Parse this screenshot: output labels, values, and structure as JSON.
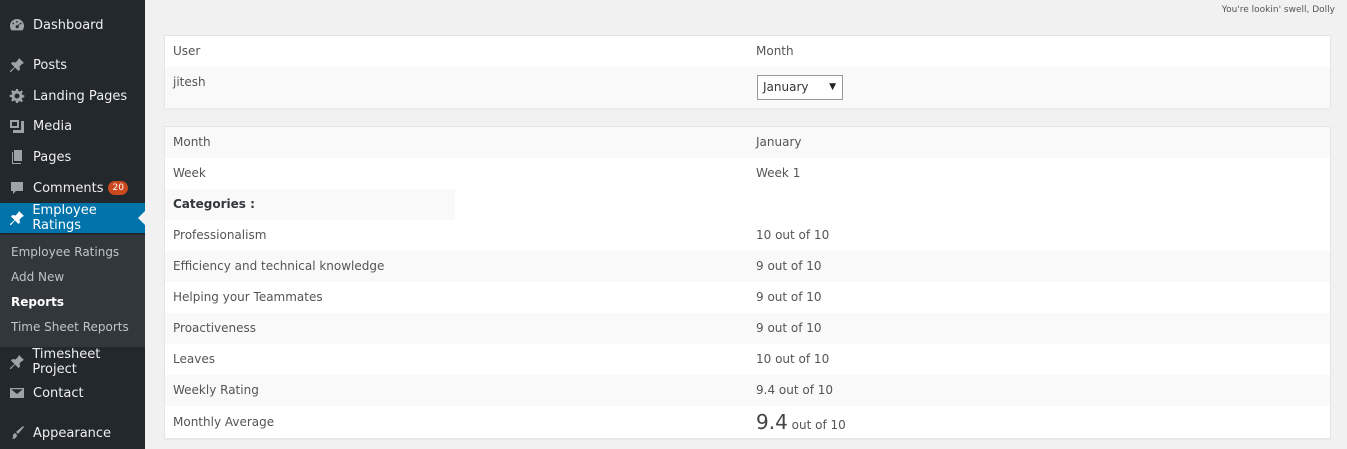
{
  "sidebar": {
    "items": [
      {
        "label": "Dashboard",
        "icon": "dashboard-icon"
      },
      {
        "label": "Posts",
        "icon": "pin-icon"
      },
      {
        "label": "Landing Pages",
        "icon": "gear-icon"
      },
      {
        "label": "Media",
        "icon": "media-icon"
      },
      {
        "label": "Pages",
        "icon": "pages-icon"
      },
      {
        "label": "Comments",
        "icon": "comment-icon",
        "badge": "20"
      },
      {
        "label": "Employee Ratings",
        "icon": "pin-icon"
      },
      {
        "label": "Timesheet Project",
        "icon": "pin-icon"
      },
      {
        "label": "Contact",
        "icon": "mail-icon"
      },
      {
        "label": "Appearance",
        "icon": "brush-icon"
      }
    ],
    "submenu": [
      "Employee Ratings",
      "Add New",
      "Reports",
      "Time Sheet Reports"
    ]
  },
  "header": {
    "dolly": "You're lookin' swell, Dolly"
  },
  "filter_table": {
    "col_user": "User",
    "col_month": "Month",
    "user_value": "jitesh",
    "month_selected": "January"
  },
  "report_table": {
    "month_label": "Month",
    "month_value": "January",
    "week_label": "Week",
    "week_value": "Week 1",
    "categories_label": "Categories :",
    "rows": [
      {
        "label": "Professionalism",
        "value": "10 out of 10"
      },
      {
        "label": "Efficiency and technical knowledge",
        "value": "9 out of 10"
      },
      {
        "label": "Helping your Teammates",
        "value": "9 out of 10"
      },
      {
        "label": "Proactiveness",
        "value": "9 out of 10"
      },
      {
        "label": "Leaves",
        "value": "10 out of 10"
      },
      {
        "label": "Weekly Rating",
        "value": "9.4 out of 10"
      }
    ],
    "monthly_label": "Monthly Average",
    "monthly_value": "9.4",
    "monthly_suffix": "out of 10"
  }
}
